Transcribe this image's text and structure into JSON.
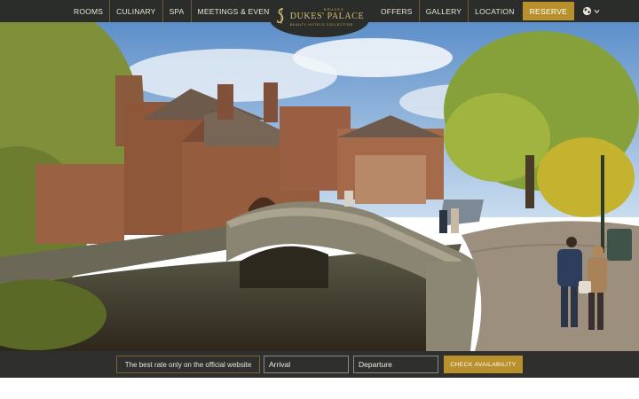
{
  "nav": {
    "left": [
      {
        "label": "ROOMS"
      },
      {
        "label": "CULINARY"
      },
      {
        "label": "SPA"
      },
      {
        "label": "MEETINGS & EVENTS"
      }
    ],
    "right": [
      {
        "label": "OFFERS"
      },
      {
        "label": "GALLERY"
      },
      {
        "label": "LOCATION"
      }
    ],
    "reserve_label": "RESERVE",
    "language_icon": "globe-icon"
  },
  "logo": {
    "top": "BRUGES",
    "name": "DUKES' PALACE",
    "sub": "BEAUTY HOTELS COLLECTION"
  },
  "booking": {
    "best_rate": "The best rate only on the official website",
    "arrival_placeholder": "Arrival",
    "departure_placeholder": "Departure",
    "check_label": "CHECK AVAILABILITY"
  },
  "colors": {
    "nav_bg": "#2b2d2a",
    "accent": "#b8912d",
    "booking_bg": "#2f302d"
  }
}
